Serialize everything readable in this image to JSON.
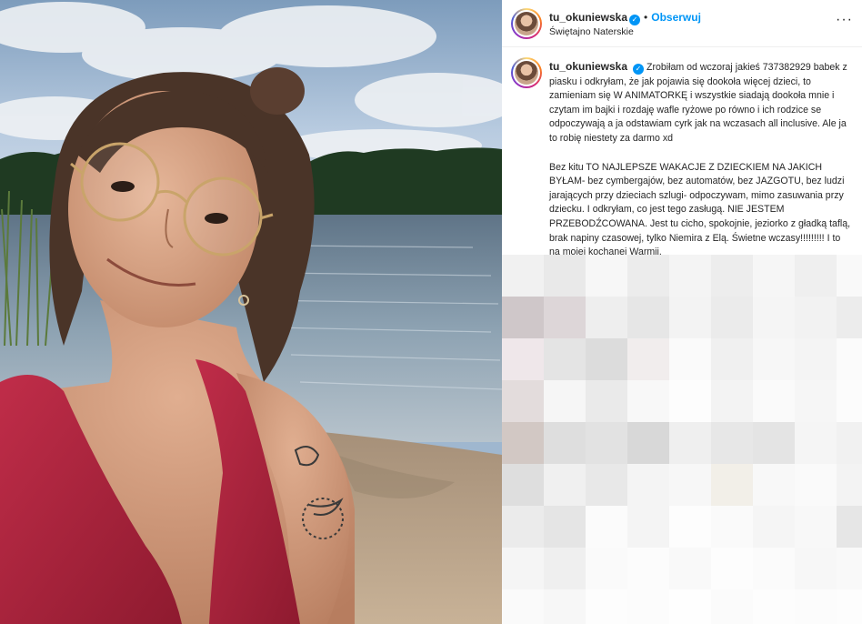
{
  "post": {
    "username": "tu_okuniewska",
    "verified_mark": "✓",
    "separator": "•",
    "follow_label": "Obserwuj",
    "location": "Świętajno Naterskie",
    "more_icon": "more-options-icon",
    "more_glyph": "···"
  },
  "caption": {
    "paragraph_1": "Zrobiłam od wczoraj jakieś 737382929 babek z piasku i odkryłam, że jak pojawia się dookoła więcej dzieci, to zamieniam się W ANIMATORKĘ i wszystkie siadają dookoła mnie i czytam im bajki i rozdaję wafle ryżowe po równo i ich rodzice se odpoczywają a ja odstawiam cyrk jak na wczasach all inclusive. Ale ja to robię niestety za darmo xd",
    "paragraph_2": "Bez kitu TO NAJLEPSZE WAKACJE Z DZIECKIEM NA JAKICH BYŁAM- bez cymbergajów, bez automatów, bez JAZGOTU, bez ludzi jarających przy dzieciach szlugi- odpoczywam, mimo zasuwania przy dziecku. I odkryłam, co jest tego zasługą. NIE JESTEM PRZEBODŹCOWANA. Jest tu cicho, spokojnie, jeziorko z gładką taflą, brak napiny czasowej, tylko Niemira z Elą. Świetne wczasy!!!!!!!!! I to na mojej kochanej Warmii."
  },
  "photo": {
    "description_icon": "selfie-photo",
    "colors": {
      "sky": "#b8cbe0",
      "cloud": "#eef1f4",
      "forest": "#1f3a22",
      "water": "#7f96a8",
      "sand": "#bfa68a",
      "dress": "#b0233d",
      "skin": "#d9a688",
      "hair": "#4a3428"
    }
  },
  "mosaic_colors": [
    "#f1f1f1",
    "#e9e9e9",
    "#f7f7f7",
    "#ececec",
    "#f4f4f4",
    "#ededed",
    "#f6f6f6",
    "#efefef",
    "#f9f9f9",
    "#cfc7c9",
    "#ddd6d8",
    "#eeeeee",
    "#e6e6e6",
    "#f3f3f3",
    "#ebebeb",
    "#f5f5f5",
    "#f2f2f2",
    "#ececec",
    "#efe7ea",
    "#e4e4e4",
    "#dcdcdc",
    "#f1eded",
    "#fafafa",
    "#f0f0f0",
    "#f7f7f7",
    "#f4f4f4",
    "#fbfbfb",
    "#e3dcdc",
    "#f6f6f6",
    "#eaeaea",
    "#f8f8f8",
    "#fdfdfd",
    "#f3f3f3",
    "#fafafa",
    "#f6f6f6",
    "#fcfcfc",
    "#d2c8c4",
    "#dedede",
    "#e2e2e2",
    "#d8d8d8",
    "#efefef",
    "#e7e7e7",
    "#e4e4e4",
    "#f5f5f5",
    "#f1f1f1",
    "#dedede",
    "#f0f0f0",
    "#e8e8e8",
    "#f4f4f4",
    "#f7f7f7",
    "#f2efe8",
    "#f8f8f8",
    "#fafafa",
    "#f3f3f3",
    "#ebebeb",
    "#e5e5e5",
    "#fbfbfb",
    "#f4f4f4",
    "#fdfdfd",
    "#fafafa",
    "#f5f5f5",
    "#f8f8f8",
    "#e6e6e6",
    "#f5f5f5",
    "#efefef",
    "#fafafa",
    "#fcfcfc",
    "#f9f9f9",
    "#fdfdfd",
    "#fbfbfb",
    "#f7f7f7",
    "#f9f9f9",
    "#fafafa",
    "#f7f7f7",
    "#fdfdfd",
    "#fcfcfc",
    "#fefefe",
    "#fbfbfb",
    "#fdfdfd",
    "#fcfcfc",
    "#fdfdfd"
  ]
}
